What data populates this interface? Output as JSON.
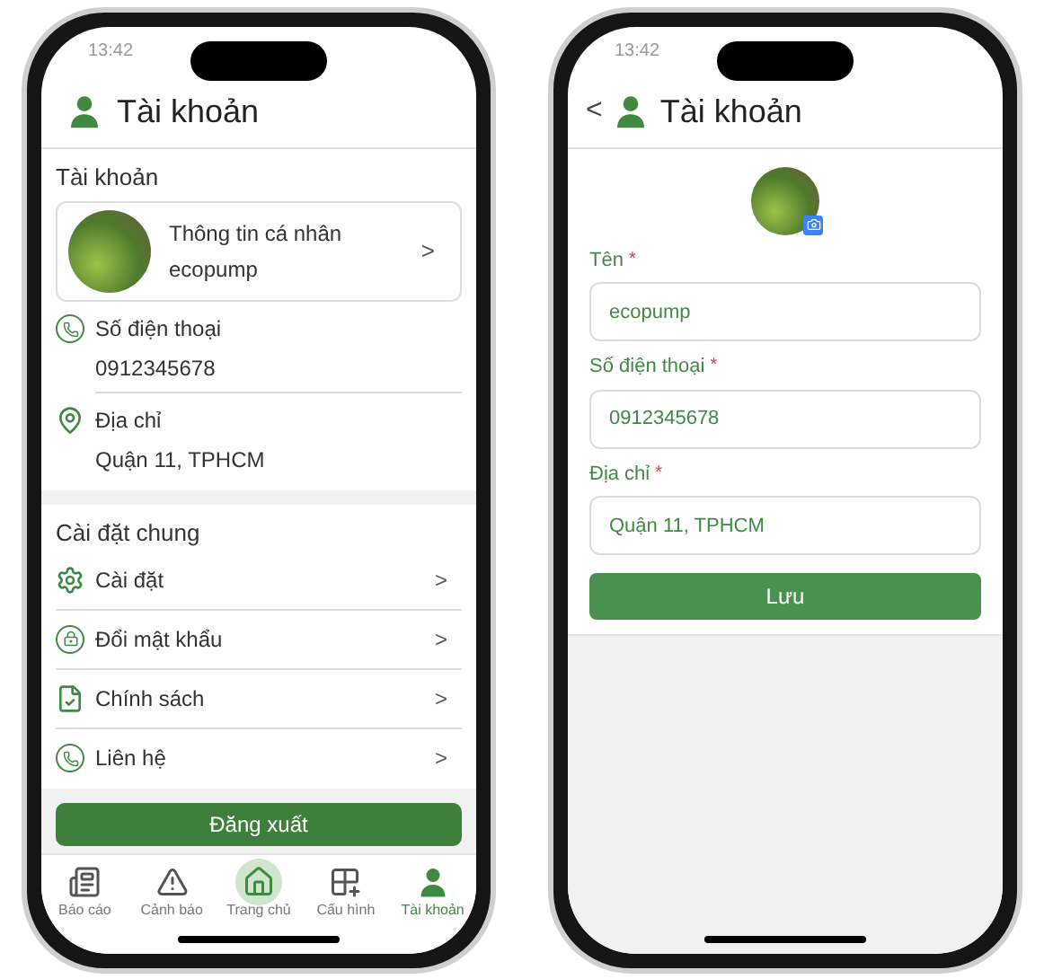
{
  "account_screen": {
    "status_time": "13:42",
    "title": "Tài khoản",
    "account_section": {
      "heading": "Tài khoản",
      "profile": {
        "title": "Thông tin cá nhân",
        "name": "ecopump",
        "chevron": ">"
      },
      "details": [
        {
          "label": "Số điện thoại",
          "value": "0912345678"
        },
        {
          "label": "Địa chỉ",
          "value": "Quận 11, TPHCM"
        }
      ]
    },
    "settings_section": {
      "heading": "Cài đặt chung",
      "items": [
        {
          "label": "Cài đặt",
          "chevron": ">"
        },
        {
          "label": "Đổi mật khẩu",
          "chevron": ">"
        },
        {
          "label": "Chính sách",
          "chevron": ">"
        },
        {
          "label": "Liên hệ",
          "chevron": ">"
        }
      ]
    },
    "logout_button": "Đăng xuất",
    "tab_bar": [
      {
        "label": "Báo cáo",
        "selected": false,
        "kind": "plain"
      },
      {
        "label": "Cảnh báo",
        "selected": false,
        "kind": "plain"
      },
      {
        "label": "Trang chủ",
        "selected": false,
        "kind": "raised"
      },
      {
        "label": "Cấu hình",
        "selected": false,
        "kind": "plain"
      },
      {
        "label": "Tài khoản",
        "selected": true,
        "kind": "plain"
      }
    ]
  },
  "edit_screen": {
    "status_time": "13:42",
    "back": "<",
    "title": "Tài khoản",
    "fields": [
      {
        "label": "Tên",
        "required_mark": "*",
        "value": "ecopump"
      },
      {
        "label": "Số điện thoại",
        "required_mark": "*",
        "value": "0912345678"
      },
      {
        "label": "Địa chỉ",
        "required_mark": "*",
        "value": "Quận 11, TPHCM"
      }
    ],
    "save_button": "Lưu"
  }
}
